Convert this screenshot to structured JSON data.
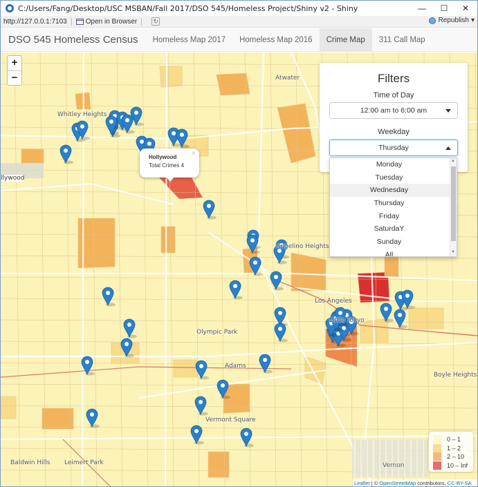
{
  "window": {
    "title": "C:/Users/Fang/Desktop/USC MSBAN/Fall 2017/DSO 545/Homeless Project/Shiny v2 - Shiny",
    "minimize": "—",
    "maximize": "☐",
    "close": "✕"
  },
  "toolbar": {
    "url": "http://127.0.0.1:7103",
    "open_in_browser": "Open in Browser",
    "refresh_icon": "refresh-icon",
    "republish": "Republish",
    "republish_caret": "▾"
  },
  "navbar": {
    "brand": "DSO 545 Homeless Census",
    "tabs": [
      {
        "label": "Homeless Map 2017",
        "active": false
      },
      {
        "label": "Homeless Map 2016",
        "active": false
      },
      {
        "label": "Crime Map",
        "active": true
      },
      {
        "label": "311 Call Map",
        "active": false
      }
    ]
  },
  "map": {
    "zoom_in": "+",
    "zoom_out": "−",
    "place_labels": [
      "Whitley Heights",
      "llywood",
      "Atwater",
      "Angelino Heights",
      "Los Angeles",
      "Little Tokyo",
      "Boyle Heights",
      "Vernon",
      "Baldwin Hills",
      "Leimert Park",
      "Vermont Square",
      "Adams",
      "Olympic Park"
    ],
    "popup": {
      "title": "Hollywood",
      "body": "Total Crimes 4",
      "close": "×"
    },
    "marker_count": 48,
    "colors": {
      "base": "#fbf3b8",
      "low": "#f8dc8a",
      "mid": "#f2b35b",
      "high": "#e7604a",
      "road": "#ffffff",
      "boundary": "#e2c48d",
      "marker": "#2a81cb"
    }
  },
  "filters": {
    "title": "Filters",
    "time_label": "Time of Day",
    "time_value": "12:00 am to 6:00 am",
    "weekday_label": "Weekday",
    "weekday_value": "Thursday",
    "weekday_options": [
      "Monday",
      "Tuesday",
      "Wednesday",
      "Thursday",
      "Friday",
      "SaturdaY",
      "Sunday",
      "All"
    ],
    "highlighted_option": "Wednesday"
  },
  "legend": {
    "items": [
      {
        "label": "0 – 1",
        "color": "#fcf6c2"
      },
      {
        "label": "1 – 2",
        "color": "#f8cf77"
      },
      {
        "label": "2 – 10",
        "color": "#f2a14a"
      },
      {
        "label": "10 – Inf",
        "color": "#e23b3b"
      }
    ]
  },
  "attribution": {
    "leaflet": "Leaflet",
    "sep": " | © ",
    "osm": "OpenStreetMap",
    "contrib": " contributors, ",
    "license": "CC-BY-SA"
  }
}
